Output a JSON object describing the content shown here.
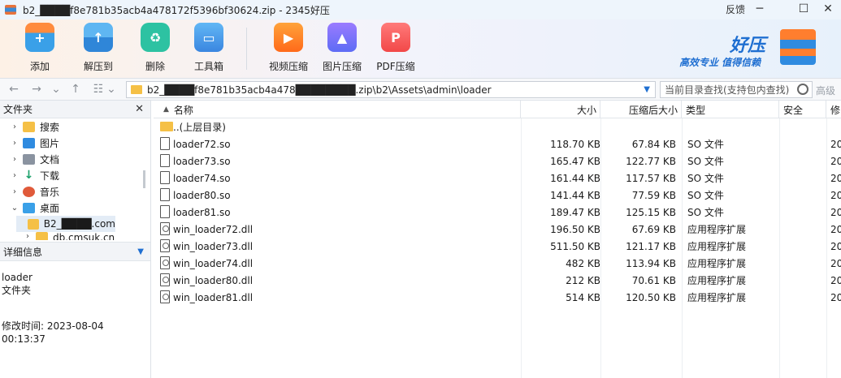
{
  "window": {
    "title": "b2_████f8e781b35acb4a478172f5396bf30624.zip - 2345好压",
    "feedback": "反馈",
    "min_glyph": "─",
    "max_glyph": "☐",
    "close_glyph": "✕"
  },
  "toolbar": {
    "items": [
      {
        "label": "添加",
        "icon": "archive-add-icon"
      },
      {
        "label": "解压到",
        "icon": "archive-extract-icon"
      },
      {
        "label": "删除",
        "icon": "recycle-bin-icon"
      },
      {
        "label": "工具箱",
        "icon": "toolbox-icon"
      },
      {
        "label": "视频压缩",
        "icon": "video-compress-icon"
      },
      {
        "label": "图片压缩",
        "icon": "image-compress-icon"
      },
      {
        "label": "PDF压缩",
        "icon": "pdf-compress-icon"
      }
    ]
  },
  "brand": {
    "name": "好压",
    "slogan": "高效专业  值得信赖"
  },
  "addressbar": {
    "path": "b2_████f8e781b35acb4a478████████.zip\\b2\\Assets\\admin\\loader",
    "search_placeholder": "当前目录查找(支持包内查找)",
    "advanced": "高级"
  },
  "leftpane": {
    "header": "文件夹",
    "close": "✕",
    "tree": [
      {
        "label": "搜索",
        "icon": "search-folder-icon"
      },
      {
        "label": "图片",
        "icon": "pictures-icon"
      },
      {
        "label": "文档",
        "icon": "documents-icon"
      },
      {
        "label": "下载",
        "icon": "download-icon"
      },
      {
        "label": "音乐",
        "icon": "music-icon"
      },
      {
        "label": "桌面",
        "icon": "desktop-icon"
      },
      {
        "label": "B2_████.com",
        "icon": "folder-icon"
      },
      {
        "label": "db.cmsuk.cn",
        "icon": "folder-icon"
      }
    ],
    "details_header": "详细信息",
    "details_name": "loader",
    "details_type": "文件夹",
    "details_modified": "修改时间:  2023-08-04 00:13:37"
  },
  "filelist": {
    "columns": {
      "name": "名称",
      "size": "大小",
      "compressed": "压缩后大小",
      "type": "类型",
      "security": "安全",
      "modified": "修"
    },
    "up_label": "..(上层目录)",
    "rows": [
      {
        "name": "loader72.so",
        "size": "118.70 KB",
        "compressed": "67.84 KB",
        "type": "SO 文件",
        "kind": "so",
        "date": "20"
      },
      {
        "name": "loader73.so",
        "size": "165.47 KB",
        "compressed": "122.77 KB",
        "type": "SO 文件",
        "kind": "so",
        "date": "20"
      },
      {
        "name": "loader74.so",
        "size": "161.44 KB",
        "compressed": "117.57 KB",
        "type": "SO 文件",
        "kind": "so",
        "date": "20"
      },
      {
        "name": "loader80.so",
        "size": "141.44 KB",
        "compressed": "77.59 KB",
        "type": "SO 文件",
        "kind": "so",
        "date": "20"
      },
      {
        "name": "loader81.so",
        "size": "189.47 KB",
        "compressed": "125.15 KB",
        "type": "SO 文件",
        "kind": "so",
        "date": "20"
      },
      {
        "name": "win_loader72.dll",
        "size": "196.50 KB",
        "compressed": "67.69 KB",
        "type": "应用程序扩展",
        "kind": "dll",
        "date": "20"
      },
      {
        "name": "win_loader73.dll",
        "size": "511.50 KB",
        "compressed": "121.17 KB",
        "type": "应用程序扩展",
        "kind": "dll",
        "date": "20"
      },
      {
        "name": "win_loader74.dll",
        "size": "482 KB",
        "compressed": "113.94 KB",
        "type": "应用程序扩展",
        "kind": "dll",
        "date": "20"
      },
      {
        "name": "win_loader80.dll",
        "size": "212 KB",
        "compressed": "70.61 KB",
        "type": "应用程序扩展",
        "kind": "dll",
        "date": "20"
      },
      {
        "name": "win_loader81.dll",
        "size": "514 KB",
        "compressed": "120.50 KB",
        "type": "应用程序扩展",
        "kind": "dll",
        "date": "20"
      }
    ]
  }
}
